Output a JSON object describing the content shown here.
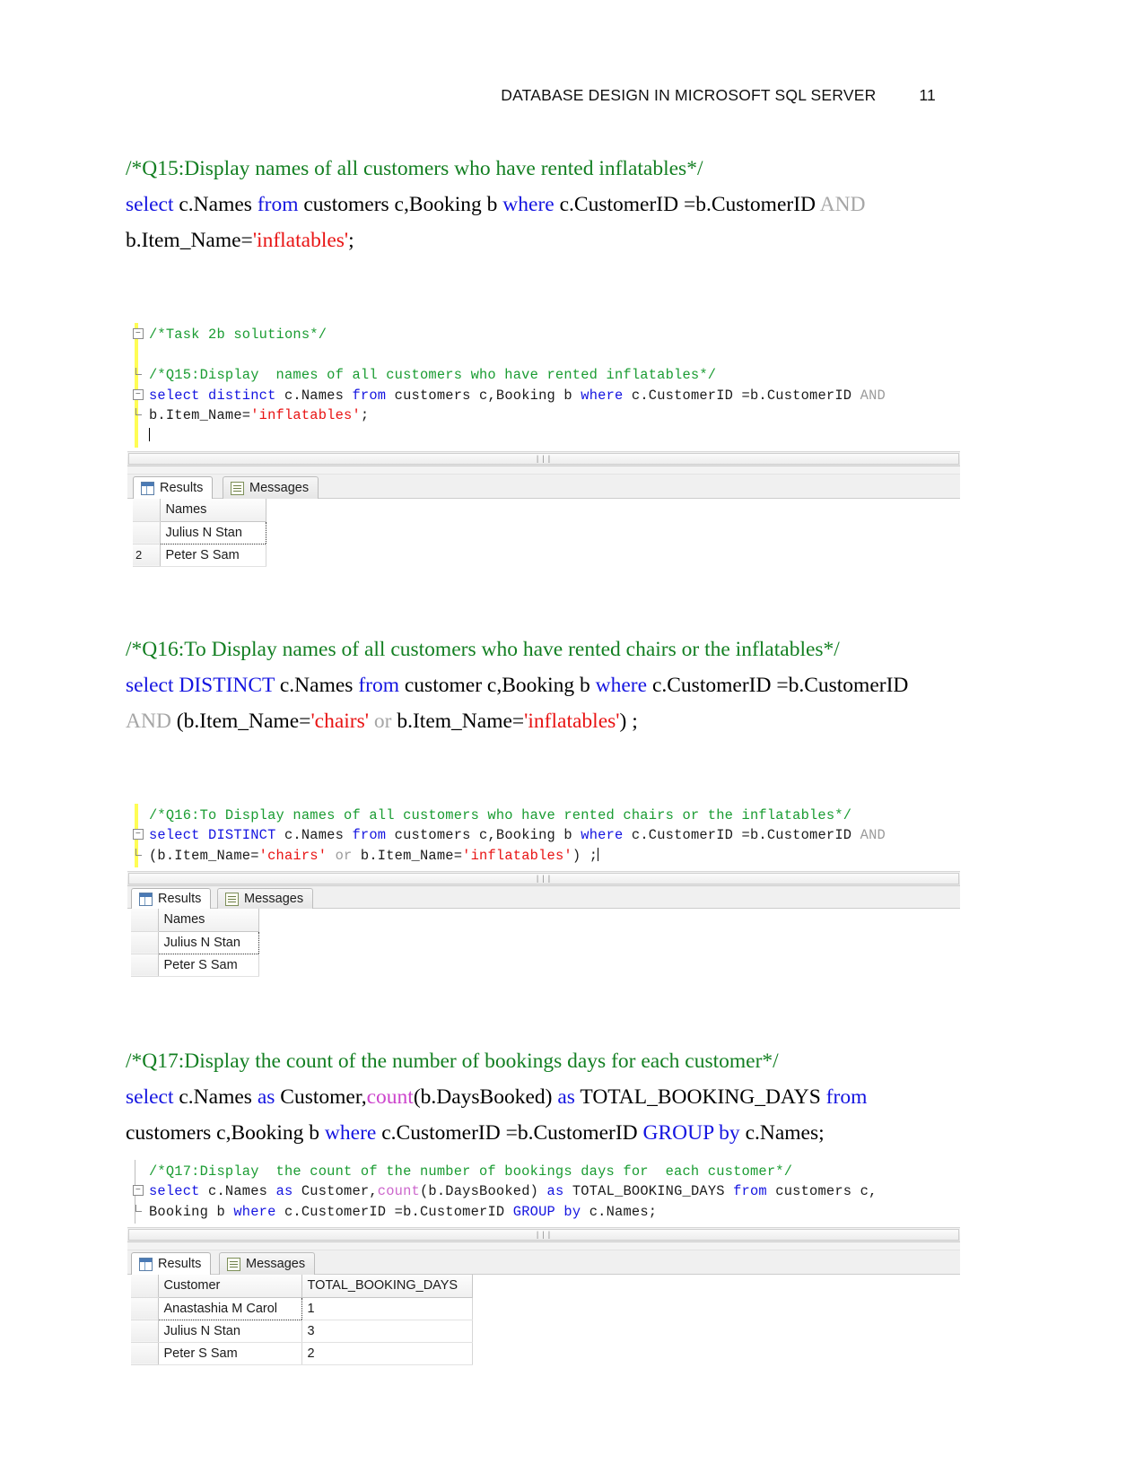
{
  "header": {
    "title": "DATABASE DESIGN IN MICROSOFT SQL SERVER",
    "page_number": "11"
  },
  "q15": {
    "comment": "/*Q15:Display  names of all customers who have rented inflatables*/",
    "line1": {
      "select": "select",
      "cols": " c.Names ",
      "from": "from",
      "tables": " customers c,Booking b ",
      "where": "where",
      "cond": " c.CustomerID =b.CustomerID ",
      "and": "AND"
    },
    "line2": {
      "lhs": "b.Item_Name=",
      "value": "'inflatables'",
      "semi": ";"
    },
    "screenshot": {
      "code": {
        "l1_comment": "/*Task 2b solutions*/",
        "l2_blank": "",
        "l3_comment": "/*Q15:Display  names of all customers who have rented inflatables*/",
        "l4_kw1": "select distinct",
        "l4_mid1": " c.Names ",
        "l4_kw2": "from",
        "l4_mid2": " customers c,Booking b ",
        "l4_kw3": "where",
        "l4_mid3": " c.CustomerID =b.CustomerID ",
        "l4_gray": "AND",
        "l5_lhs": "b.Item_Name=",
        "l5_str": "'inflatables'",
        "l5_end": ";"
      },
      "tabs": {
        "results": "Results",
        "messages": "Messages"
      },
      "grid": {
        "columns": [
          "Names"
        ],
        "rows": [
          {
            "marker": "",
            "values": [
              "Julius N Stan"
            ]
          },
          {
            "marker": "2",
            "values": [
              "Peter S Sam"
            ]
          }
        ]
      }
    }
  },
  "q16": {
    "comment": "/*Q16:To Display names of all customers who have rented chairs or the inflatables*/",
    "line1": {
      "select": "select DISTINCT",
      "cols": " c.Names ",
      "from": "from",
      "tables": " customer c,Booking b ",
      "where": "where",
      "cond": " c.CustomerID =b.CustomerID"
    },
    "line2": {
      "and": "AND",
      "open": " (b.Item_Name=",
      "v1": "'chairs'",
      "or": " or ",
      "lhs2": "b.Item_Name=",
      "v2": "'inflatables'",
      "close": ") ;"
    },
    "screenshot": {
      "code": {
        "l1_comment": "/*Q16:To Display names of all customers who have rented chairs or the inflatables*/",
        "l2_kw1": "select DISTINCT",
        "l2_mid1": " c.Names ",
        "l2_kw2": "from",
        "l2_mid2": " customers c,Booking b ",
        "l2_kw3": "where",
        "l2_mid3": " c.CustomerID =b.CustomerID ",
        "l2_gray": "AND",
        "l3_open": "(b.Item_Name=",
        "l3_v1": "'chairs'",
        "l3_or": " or ",
        "l3_lhs2": "b.Item_Name=",
        "l3_v2": "'inflatables'",
        "l3_close": ") ;"
      },
      "tabs": {
        "results": "Results",
        "messages": "Messages"
      },
      "grid": {
        "columns": [
          "Names"
        ],
        "rows": [
          {
            "marker": "",
            "values": [
              "Julius N Stan"
            ]
          },
          {
            "marker": "",
            "values": [
              "Peter S Sam"
            ]
          }
        ]
      }
    }
  },
  "q17": {
    "comment": "/*Q17:Display  the count of the number of bookings days for  each customer*/",
    "line1": {
      "select": "select",
      "p1": " c.Names ",
      "as1": "as",
      "p2": " Customer,",
      "count": "count",
      "p3": "(b.DaysBooked) ",
      "as2": "as",
      "p4": " TOTAL_BOOKING_DAYS ",
      "from": "from"
    },
    "line2": {
      "p1": "customers c,Booking b ",
      "where": "where",
      "p2": " c.CustomerID =b.CustomerID ",
      "group": "GROUP by",
      "p3": " c.Names;"
    },
    "screenshot": {
      "code": {
        "l1_comment": "/*Q17:Display  the count of the number of bookings days for  each customer*/",
        "l2_kw1": "select",
        "l2_p1": " c.Names ",
        "l2_kw2": "as",
        "l2_p2": " Customer,",
        "l2_fn": "count",
        "l2_p3": "(b.DaysBooked) ",
        "l2_kw3": "as",
        "l2_p4": " TOTAL_BOOKING_DAYS ",
        "l2_kw4": "from",
        "l2_p5": " customers c,",
        "l3_p1": "Booking b ",
        "l3_kw1": "where",
        "l3_p2": " c.CustomerID =b.CustomerID ",
        "l3_kw2": "GROUP by",
        "l3_p3": " c.Names;"
      },
      "tabs": {
        "results": "Results",
        "messages": "Messages"
      },
      "grid": {
        "columns": [
          "Customer",
          "TOTAL_BOOKING_DAYS"
        ],
        "rows": [
          {
            "marker": "",
            "values": [
              "Anastashia M Carol",
              "1"
            ]
          },
          {
            "marker": "",
            "values": [
              "Julius N Stan",
              "3"
            ]
          },
          {
            "marker": "",
            "values": [
              "Peter S Sam",
              "2"
            ]
          }
        ]
      }
    }
  },
  "icons": {
    "grid_icon": "results-grid-icon",
    "message_icon": "messages-icon",
    "scroll_grip": "scrollbar-grip-icon"
  },
  "colors": {
    "comment_green": "#137f22",
    "keyword_blue": "#1414e0",
    "string_red": "#e81313",
    "function_pink": "#cc44cc",
    "gray_keyword": "#a6a6a6"
  }
}
